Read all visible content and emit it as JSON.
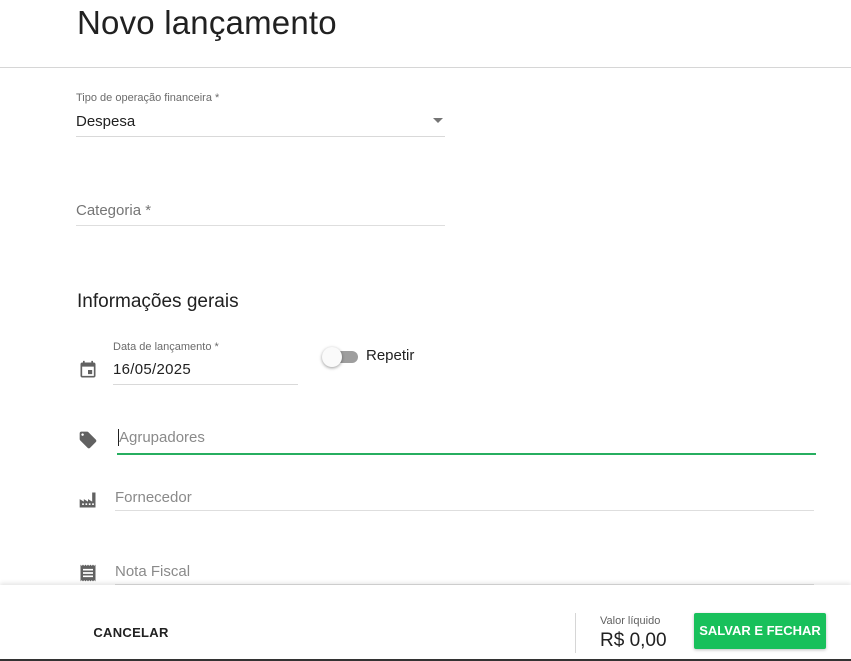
{
  "header": {
    "title": "Novo lançamento"
  },
  "form": {
    "operation_type": {
      "label": "Tipo de operação financeira *",
      "value": "Despesa"
    },
    "category": {
      "label": "Categoria *"
    },
    "section_title": "Informações gerais",
    "date": {
      "label": "Data de lançamento *",
      "value": "16/05/2025"
    },
    "repeat": {
      "label": "Repetir",
      "enabled": false
    },
    "groupers": {
      "placeholder": "Agrupadores"
    },
    "supplier": {
      "placeholder": "Fornecedor"
    },
    "invoice": {
      "placeholder": "Nota Fiscal"
    }
  },
  "footer": {
    "cancel_label": "CANCELAR",
    "net_value_label": "Valor líquido",
    "net_value": "R$ 0,00",
    "save_label": "SALVAR E FECHAR"
  },
  "colors": {
    "accent": "#18c05b",
    "focus_underline": "#27ae60",
    "icon": "#616161"
  },
  "icons": {
    "date": "calendar-icon",
    "groupers": "tag-icon",
    "supplier": "factory-icon",
    "invoice": "receipt-icon",
    "select": "dropdown-arrow-icon"
  }
}
